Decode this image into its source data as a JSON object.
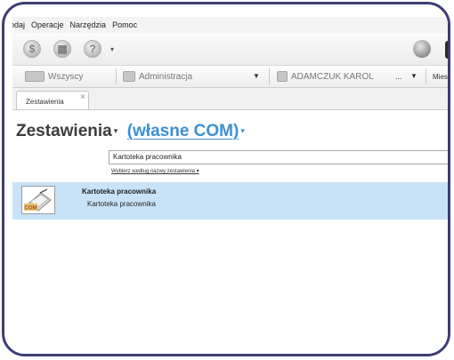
{
  "menu": {
    "items": [
      "odaj",
      "Operacje",
      "Narzędzia",
      "Pomoc"
    ]
  },
  "toolbar": {
    "icons": [
      "dollar-icon",
      "calculator-icon",
      "help-icon"
    ],
    "help_glyph": "?",
    "dropdown_glyph": "▾"
  },
  "context": {
    "filter_all_label": "Wszyscy",
    "department_label": "Administracja",
    "employee_label": "ADAMCZUK KAROL",
    "employee_more": "...",
    "period_label": "Miesiąc",
    "arrow": "▼"
  },
  "tabs": [
    {
      "label": "Zestawienia",
      "close": "×"
    }
  ],
  "page": {
    "title": "Zestawienia",
    "title_dd": "▾",
    "subtitle": "(własne COM)",
    "subtitle_dd": "▾"
  },
  "search": {
    "value": "Kartoteka pracownika",
    "chooser_label": "Wybierz według nazwy zestawienia ▾"
  },
  "results": [
    {
      "title": "Kartoteka pracownika",
      "description": "Kartoteka pracownika",
      "icon_badge": "COM"
    }
  ],
  "colors": {
    "frame_border": "#3d3c78",
    "accent_blue": "#3d8fd6",
    "selected_row": "#c8e2f7"
  }
}
